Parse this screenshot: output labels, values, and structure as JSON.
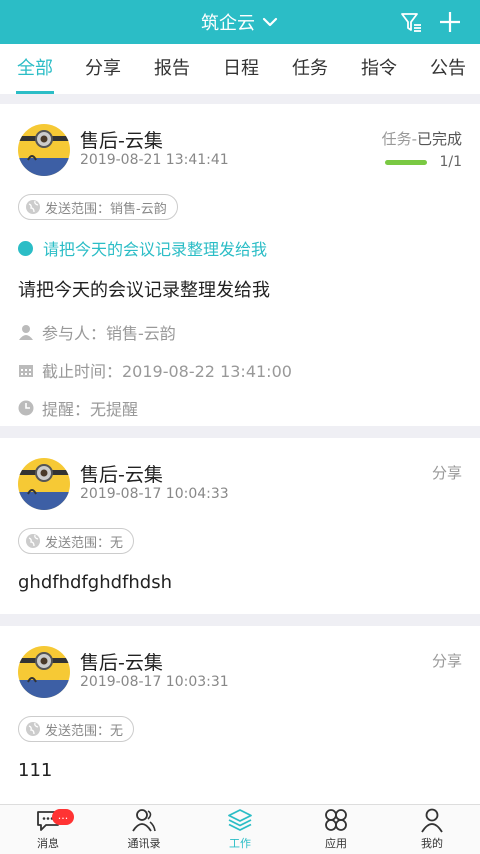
{
  "header": {
    "title": "筑企云"
  },
  "tabs": [
    {
      "label": "全部",
      "active": true
    },
    {
      "label": "分享"
    },
    {
      "label": "报告"
    },
    {
      "label": "日程"
    },
    {
      "label": "任务"
    },
    {
      "label": "指令"
    },
    {
      "label": "公告"
    }
  ],
  "posts": [
    {
      "user": "售后-云集",
      "time": "2019-08-21 13:41:41",
      "type_prefix": "任务-",
      "type_status": "已完成",
      "progress_label": "1/1",
      "progress_fraction": 1.0,
      "scope": "发送范围：销售-云韵",
      "task_title": "请把今天的会议记录整理发给我",
      "content": "请把今天的会议记录整理发给我",
      "participants": "参与人：销售-云韵",
      "deadline": "截止时间：2019-08-22 13:41:00",
      "reminder": "提醒：无提醒"
    },
    {
      "user": "售后-云集",
      "time": "2019-08-17 10:04:33",
      "type": "分享",
      "scope": "发送范围：无",
      "content": "ghdfhdfghdfhdsh"
    },
    {
      "user": "售后-云集",
      "time": "2019-08-17 10:03:31",
      "type": "分享",
      "scope": "发送范围：无",
      "content": "111"
    }
  ],
  "bottom_nav": [
    {
      "label": "消息",
      "icon": "chat-icon",
      "badge": "..."
    },
    {
      "label": "通讯录",
      "icon": "contacts-icon"
    },
    {
      "label": "工作",
      "icon": "layers-icon",
      "active": true
    },
    {
      "label": "应用",
      "icon": "apps-icon"
    },
    {
      "label": "我的",
      "icon": "person-icon"
    }
  ],
  "colors": {
    "accent": "#2bbdc6",
    "progress": "#7ac943",
    "badge": "#ff3333"
  }
}
